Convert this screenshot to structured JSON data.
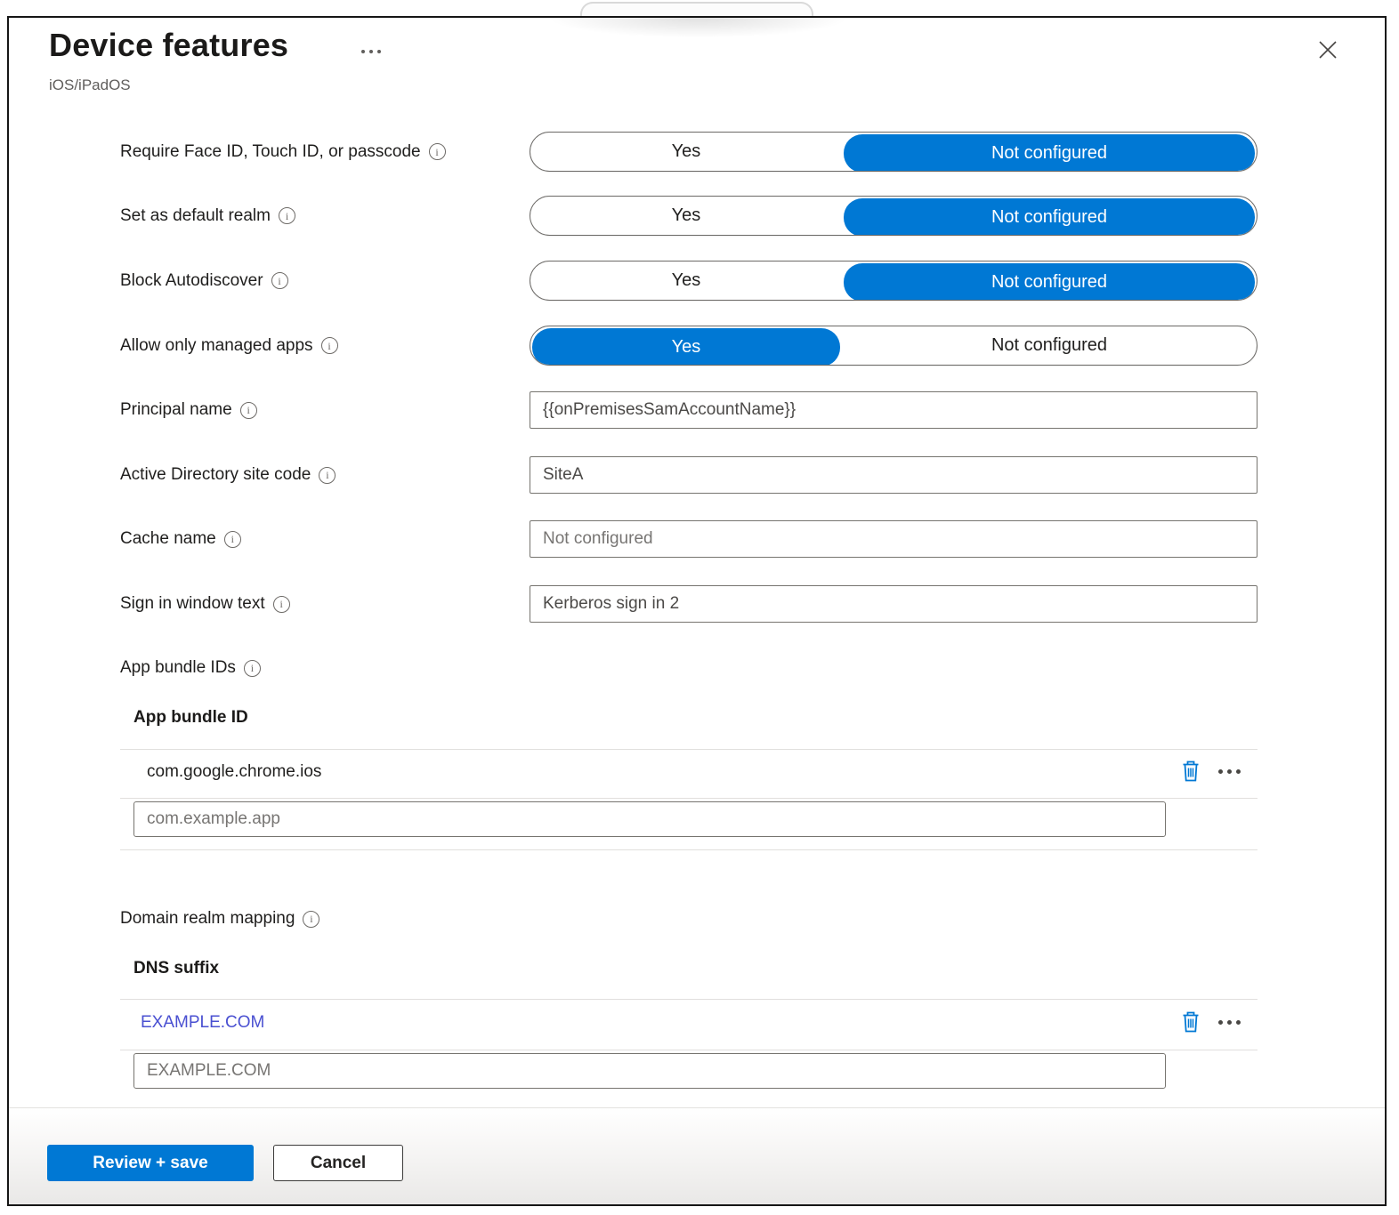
{
  "dialog": {
    "title": "Device features",
    "subtitle": "iOS/iPadOS"
  },
  "toggles": [
    {
      "label": "Require Face ID, Touch ID, or passcode",
      "options": [
        "Yes",
        "Not configured"
      ],
      "selected": 1
    },
    {
      "label": "Set as default realm",
      "options": [
        "Yes",
        "Not configured"
      ],
      "selected": 1
    },
    {
      "label": "Block Autodiscover",
      "options": [
        "Yes",
        "Not configured"
      ],
      "selected": 1
    },
    {
      "label": "Allow only managed apps",
      "options": [
        "Yes",
        "Not configured"
      ],
      "selected": 0
    }
  ],
  "text_fields": [
    {
      "label": "Principal name",
      "value": "{{onPremisesSamAccountName}}",
      "placeholder": ""
    },
    {
      "label": "Active Directory site code",
      "value": "SiteA",
      "placeholder": ""
    },
    {
      "label": "Cache name",
      "value": "",
      "placeholder": "Not configured"
    },
    {
      "label": "Sign in window text",
      "value": "Kerberos sign in 2",
      "placeholder": ""
    }
  ],
  "app_bundle": {
    "label": "App bundle IDs",
    "column_header": "App bundle ID",
    "rows": [
      {
        "value": "com.google.chrome.ios"
      }
    ],
    "input_placeholder": "com.example.app"
  },
  "domain_realm": {
    "label": "Domain realm mapping",
    "column_header": "DNS suffix",
    "rows": [
      {
        "value": "EXAMPLE.COM"
      }
    ],
    "input_placeholder": "EXAMPLE.COM"
  },
  "footer": {
    "save_label": "Review + save",
    "cancel_label": "Cancel"
  },
  "colors": {
    "accent": "#0078d4",
    "link": "#4a50d1"
  }
}
